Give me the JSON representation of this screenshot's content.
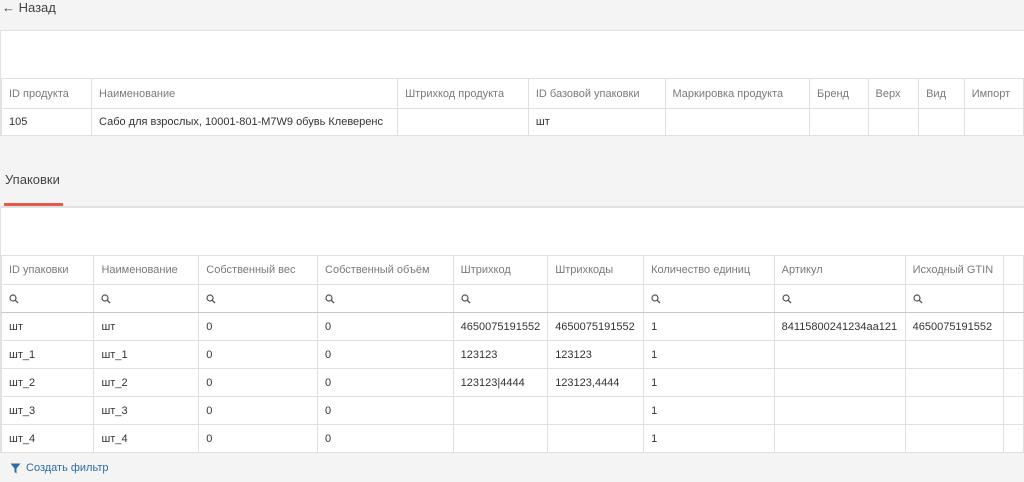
{
  "nav": {
    "back_label": "← Назад"
  },
  "product": {
    "columns": [
      "ID продукта",
      "Наименование",
      "Штрихкод продукта",
      "ID базовой упаковки",
      "Маркировка продукта",
      "Бренд",
      "Верх",
      "Вид",
      "Импорт"
    ],
    "row": [
      "105",
      "Сабо для взрослых, 10001-801-M7W9 обувь Клеверенс",
      "",
      "шт",
      "",
      "",
      "",
      "",
      ""
    ]
  },
  "packages": {
    "tab_label": "Упаковки",
    "columns": [
      "ID упаковки",
      "Наименование",
      "Собственный вес",
      "Собственный объём",
      "Штрихкод",
      "Штрихкоды",
      "Количество единиц",
      "Артикул",
      "Исходный GTIN",
      ""
    ],
    "rows": [
      [
        "шт",
        "шт",
        "0",
        "0",
        "4650075191552",
        "4650075191552",
        "1",
        "84115800241234aa121",
        "4650075191552",
        ""
      ],
      [
        "шт_1",
        "шт_1",
        "0",
        "0",
        "123123",
        "123123",
        "1",
        "",
        "",
        ""
      ],
      [
        "шт_2",
        "шт_2",
        "0",
        "0",
        "123123|4444",
        "123123,4444",
        "1",
        "",
        "",
        ""
      ],
      [
        "шт_3",
        "шт_3",
        "0",
        "0",
        "",
        "",
        "1",
        "",
        "",
        ""
      ],
      [
        "шт_4",
        "шт_4",
        "0",
        "0",
        "",
        "",
        "1",
        "",
        "",
        ""
      ]
    ],
    "create_filter_label": "Создать фильтр"
  },
  "colors": {
    "accent_underline": "#e05a4f",
    "link": "#2e6da4"
  }
}
